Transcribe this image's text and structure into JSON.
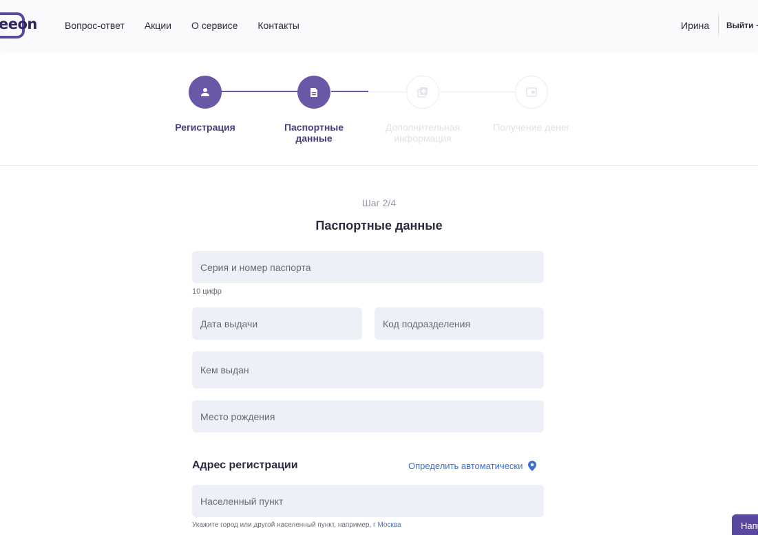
{
  "header": {
    "logo_text": "eeon",
    "nav": [
      "Вопрос-ответ",
      "Акции",
      "О сервисе",
      "Контакты"
    ],
    "user_name": "Ирина",
    "logout": "Выйти"
  },
  "stepper": {
    "steps": [
      {
        "label_line1": "Регистрация",
        "label_line2": "",
        "state": "done",
        "icon": "user-icon"
      },
      {
        "label_line1": "Паспортные",
        "label_line2": "данные",
        "state": "current",
        "icon": "document-icon"
      },
      {
        "label_line1": "Дополнительная",
        "label_line2": "информация",
        "state": "upcoming",
        "icon": "add-document-icon"
      },
      {
        "label_line1": "Получение денег",
        "label_line2": "",
        "state": "upcoming",
        "icon": "wallet-icon"
      }
    ]
  },
  "form": {
    "step_counter": "Шаг 2/4",
    "title": "Паспортные данные",
    "passport_placeholder": "Серия и номер паспорта",
    "passport_hint": "10 цифр",
    "issue_date_placeholder": "Дата выдачи",
    "division_code_placeholder": "Код подразделения",
    "issued_by_placeholder": "Кем выдан",
    "birthplace_placeholder": "Место рождения",
    "address_title": "Адрес регистрации",
    "auto_detect": "Определить автоматически",
    "locality_placeholder": "Населенный пункт",
    "locality_hint": "Укажите город или другой населенный пункт, например,",
    "locality_hint_example": "г Москва"
  },
  "help_button": "Написать",
  "colors": {
    "accent": "#6b57a8",
    "link": "#3b6fd1",
    "field_bg": "#eef0f7"
  }
}
